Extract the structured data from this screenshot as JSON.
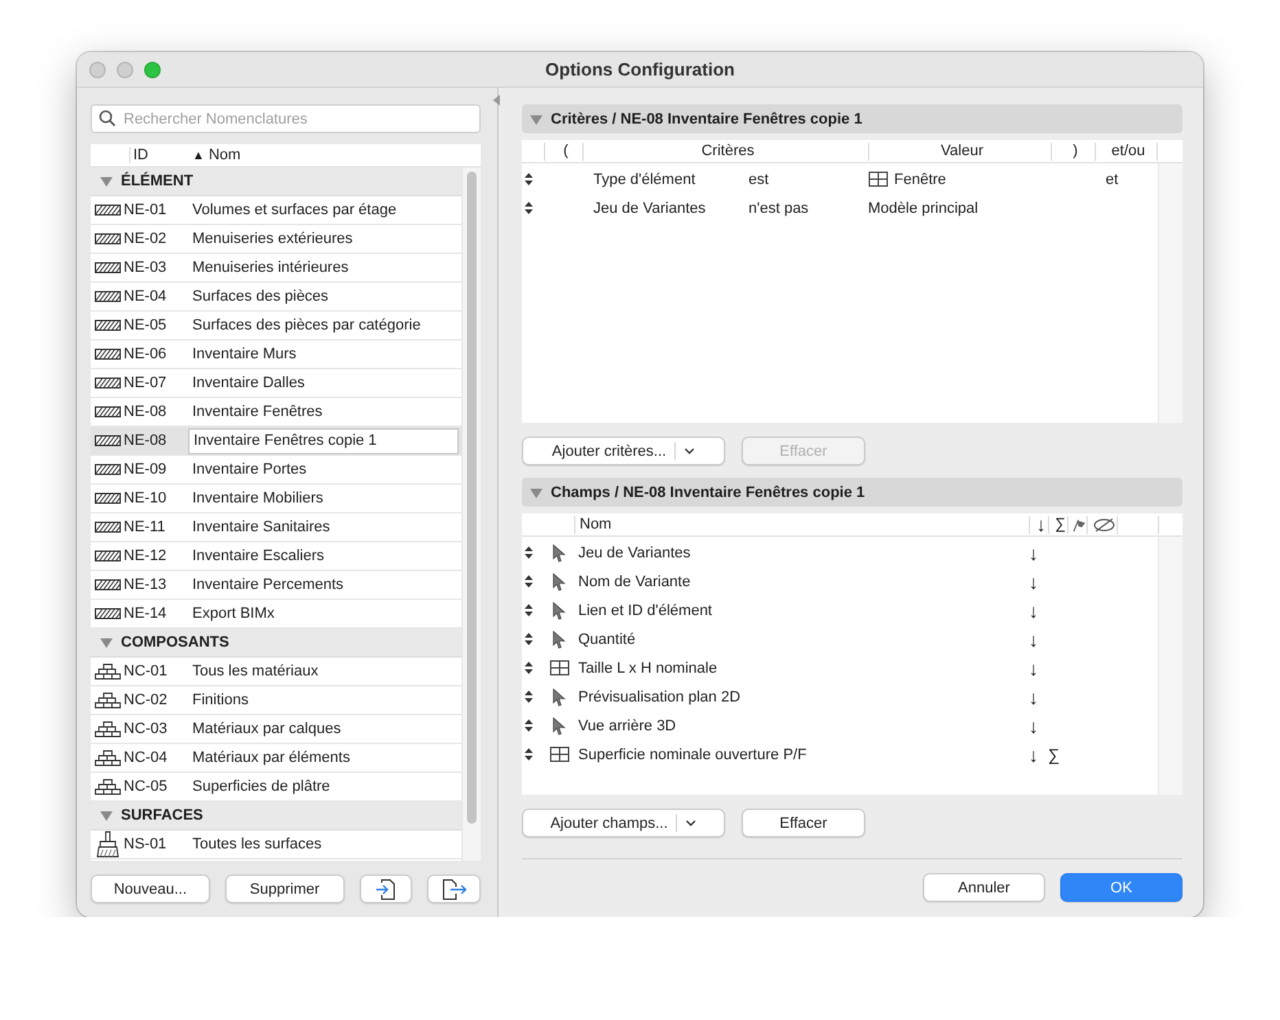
{
  "window": {
    "title": "Options Configuration"
  },
  "sidebar": {
    "search": {
      "placeholder": "Rechercher Nomenclatures"
    },
    "columns": {
      "id": "ID",
      "sort_indicator": "▲",
      "name": "Nom"
    },
    "groups": [
      {
        "label": "ÉLÉMENT",
        "expanded": true,
        "kind": "element",
        "items": [
          {
            "id": "NE-01",
            "name": "Volumes et surfaces par étage",
            "selected": false
          },
          {
            "id": "NE-02",
            "name": "Menuiseries extérieures",
            "selected": false
          },
          {
            "id": "NE-03",
            "name": "Menuiseries intérieures",
            "selected": false
          },
          {
            "id": "NE-04",
            "name": "Surfaces des pièces",
            "selected": false
          },
          {
            "id": "NE-05",
            "name": "Surfaces des pièces par catégorie",
            "selected": false
          },
          {
            "id": "NE-06",
            "name": "Inventaire Murs",
            "selected": false
          },
          {
            "id": "NE-07",
            "name": "Inventaire Dalles",
            "selected": false
          },
          {
            "id": "NE-08",
            "name": "Inventaire Fenêtres",
            "selected": false
          },
          {
            "id": "NE-08",
            "name": "Inventaire Fenêtres copie 1",
            "selected": true
          },
          {
            "id": "NE-09",
            "name": "Inventaire Portes",
            "selected": false
          },
          {
            "id": "NE-10",
            "name": "Inventaire Mobiliers",
            "selected": false
          },
          {
            "id": "NE-11",
            "name": "Inventaire Sanitaires",
            "selected": false
          },
          {
            "id": "NE-12",
            "name": "Inventaire Escaliers",
            "selected": false
          },
          {
            "id": "NE-13",
            "name": "Inventaire Percements",
            "selected": false
          },
          {
            "id": "NE-14",
            "name": "Export BIMx",
            "selected": false
          }
        ]
      },
      {
        "label": "COMPOSANTS",
        "expanded": true,
        "kind": "component",
        "items": [
          {
            "id": "NC-01",
            "name": "Tous les matériaux",
            "selected": false
          },
          {
            "id": "NC-02",
            "name": "Finitions",
            "selected": false
          },
          {
            "id": "NC-03",
            "name": "Matériaux par calques",
            "selected": false
          },
          {
            "id": "NC-04",
            "name": "Matériaux par éléments",
            "selected": false
          },
          {
            "id": "NC-05",
            "name": "Superficies de plâtre",
            "selected": false
          }
        ]
      },
      {
        "label": "SURFACES",
        "expanded": true,
        "kind": "surface",
        "items": [
          {
            "id": "NS-01",
            "name": "Toutes les surfaces",
            "selected": false
          }
        ]
      }
    ],
    "buttons": [
      {
        "kind": "text",
        "label": "Nouveau..."
      },
      {
        "kind": "text",
        "label": "Supprimer"
      },
      {
        "kind": "import"
      },
      {
        "kind": "export"
      }
    ]
  },
  "criteria": {
    "title": "Critères / NE-08 Inventaire Fenêtres copie 1",
    "expanded": true,
    "columns": [
      "(",
      "Critères",
      "Valeur",
      ")",
      "et/ou"
    ],
    "rows": [
      {
        "criterion": "Type d'élément",
        "operator": "est",
        "value": "Fenêtre",
        "kind": "element_type",
        "conjunction": "et"
      },
      {
        "criterion": "Jeu de Variantes",
        "operator": "n'est pas",
        "value": "Modèle principal",
        "kind": "text"
      }
    ],
    "buttons": [
      {
        "label": "Ajouter critères...",
        "menu": true,
        "disabled": false
      },
      {
        "label": "Effacer",
        "menu": false,
        "disabled": true
      }
    ]
  },
  "fields": {
    "title": "Champs / NE-08 Inventaire Fenêtres copie 1",
    "expanded": true,
    "columns": {
      "name": "Nom",
      "sort": "↓",
      "sum": "∑"
    },
    "rows": [
      {
        "name": "Jeu de Variantes",
        "kind": "general",
        "sort": "↓"
      },
      {
        "name": "Nom de Variante",
        "kind": "general",
        "sort": "↓"
      },
      {
        "name": "Lien et ID d'élément",
        "kind": "general",
        "sort": "↓"
      },
      {
        "name": "Quantité",
        "kind": "general",
        "sort": "↓"
      },
      {
        "name": "Taille L x H nominale",
        "kind": "window",
        "sort": "↓"
      },
      {
        "name": "Prévisualisation plan 2D",
        "kind": "general",
        "sort": "↓"
      },
      {
        "name": "Vue arrière 3D",
        "kind": "general",
        "sort": "↓"
      },
      {
        "name": "Superficie nominale ouverture P/F",
        "kind": "window",
        "sort": "↓",
        "sum": "∑"
      }
    ],
    "buttons": [
      {
        "label": "Ajouter champs...",
        "menu": true,
        "disabled": false
      },
      {
        "label": "Effacer",
        "menu": false,
        "disabled": false
      }
    ]
  },
  "footer": {
    "buttons": [
      {
        "label": "Annuler",
        "primary": false
      },
      {
        "label": "OK",
        "primary": true
      }
    ]
  }
}
